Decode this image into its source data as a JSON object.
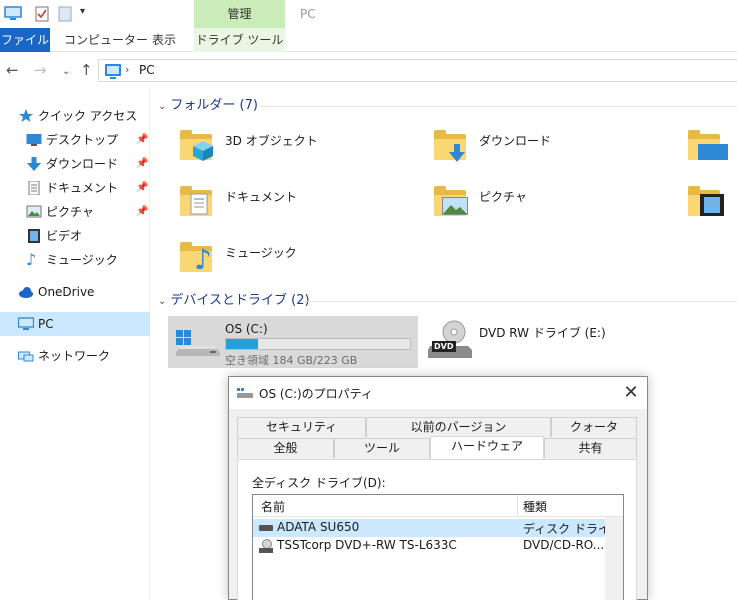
{
  "titlebar": {
    "context_tab": "管理",
    "window_title": "PC"
  },
  "ribbon": {
    "tabs": [
      "ファイル",
      "コンピューター",
      "表示",
      "ドライブ ツール"
    ]
  },
  "address": {
    "path": "PC"
  },
  "nav": {
    "quick_access": "クイック アクセス",
    "quick_items": [
      "デスクトップ",
      "ダウンロード",
      "ドキュメント",
      "ピクチャ",
      "ビデオ",
      "ミュージック"
    ],
    "onedrive": "OneDrive",
    "pc": "PC",
    "network": "ネットワーク"
  },
  "content": {
    "folders_header": "フォルダー (7)",
    "folders": [
      "3D オブジェクト",
      "ダウンロード",
      "ドキュメント",
      "ピクチャ",
      "ミュージック"
    ],
    "devices_header": "デバイスとドライブ (2)",
    "drive_c": {
      "name": "OS (C:)",
      "free_text": "空き領域 184 GB/223 GB",
      "used_fraction": 0.175
    },
    "dvd": {
      "name": "DVD RW ドライブ (E:)",
      "badge": "DVD"
    }
  },
  "dialog": {
    "title": "OS (C:)のプロパティ",
    "close": "✕",
    "tabs_row1": [
      "セキュリティ",
      "以前のバージョン",
      "クォータ"
    ],
    "tabs_row2": [
      "全般",
      "ツール",
      "ハードウェア",
      "共有"
    ],
    "panel_label": "全ディスク ドライブ(D):",
    "columns": [
      "名前",
      "種類"
    ],
    "rows": [
      {
        "name": "ADATA SU650",
        "type": "ディスク ドライブ"
      },
      {
        "name": "TSSTcorp DVD+-RW TS-L633C",
        "type": "DVD/CD-RO..."
      }
    ]
  },
  "colors": {
    "accent": "#1a66c7",
    "context": "#c9ecb8",
    "selection": "#cce8ff",
    "bar": "#26a0da"
  }
}
